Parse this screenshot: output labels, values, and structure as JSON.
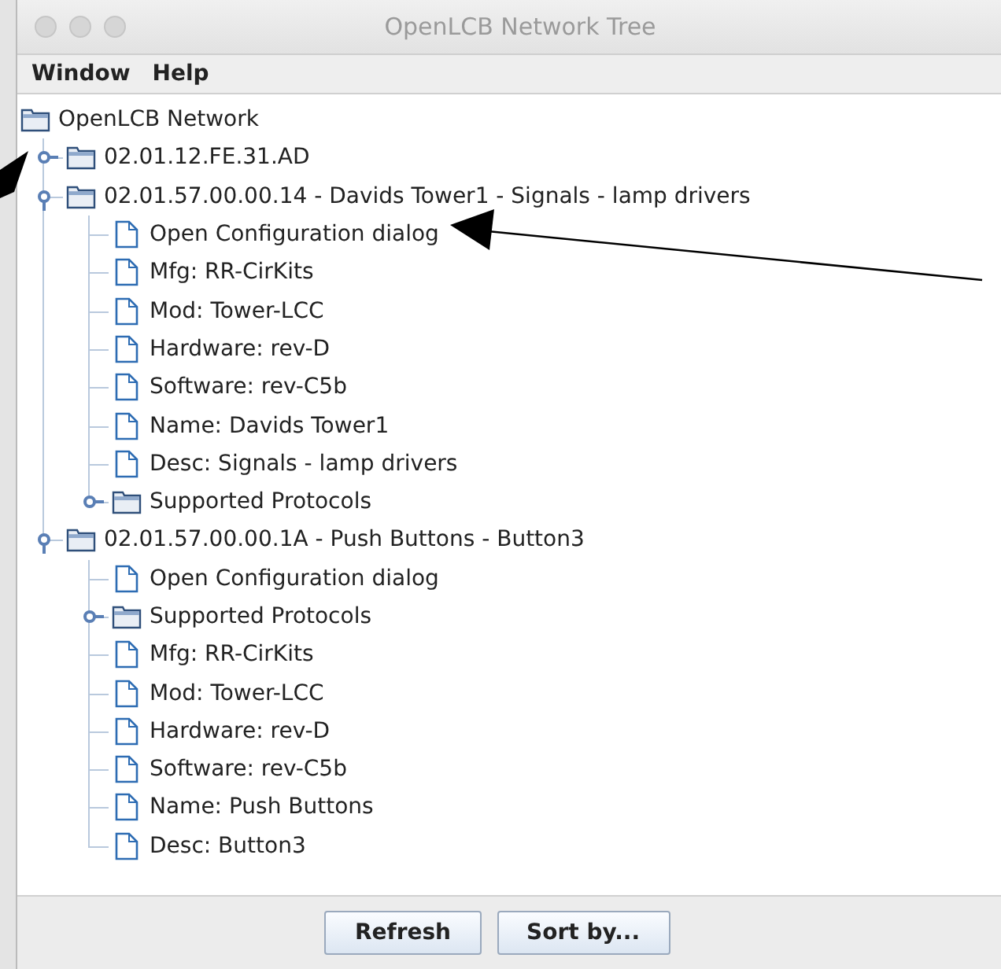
{
  "window": {
    "title": "OpenLCB Network Tree"
  },
  "menu": [
    "Window",
    "Help"
  ],
  "tree": {
    "label": "OpenLCB Network",
    "kind": "folder",
    "children": [
      {
        "label": "02.01.12.FE.31.AD",
        "kind": "folder",
        "expanded": false
      },
      {
        "label": "02.01.57.00.00.14 - Davids Tower1 - Signals - lamp drivers",
        "kind": "folder",
        "expanded": true,
        "children": [
          {
            "label": "Open Configuration dialog",
            "kind": "file"
          },
          {
            "label": "Mfg: RR-CirKits",
            "kind": "file"
          },
          {
            "label": "Mod: Tower-LCC",
            "kind": "file"
          },
          {
            "label": "Hardware: rev-D",
            "kind": "file"
          },
          {
            "label": "Software: rev-C5b",
            "kind": "file"
          },
          {
            "label": "Name: Davids Tower1",
            "kind": "file"
          },
          {
            "label": "Desc: Signals - lamp drivers",
            "kind": "file"
          },
          {
            "label": "Supported Protocols",
            "kind": "folder",
            "expanded": false
          }
        ]
      },
      {
        "label": "02.01.57.00.00.1A - Push Buttons - Button3",
        "kind": "folder",
        "expanded": true,
        "children": [
          {
            "label": "Open Configuration dialog",
            "kind": "file"
          },
          {
            "label": "Supported Protocols",
            "kind": "folder",
            "expanded": false
          },
          {
            "label": "Mfg: RR-CirKits",
            "kind": "file"
          },
          {
            "label": "Mod: Tower-LCC",
            "kind": "file"
          },
          {
            "label": "Hardware: rev-D",
            "kind": "file"
          },
          {
            "label": "Software: rev-C5b",
            "kind": "file"
          },
          {
            "label": "Name: Push Buttons",
            "kind": "file"
          },
          {
            "label": "Desc: Button3",
            "kind": "file"
          }
        ]
      }
    ]
  },
  "buttons": [
    "Refresh",
    "Sort by..."
  ]
}
